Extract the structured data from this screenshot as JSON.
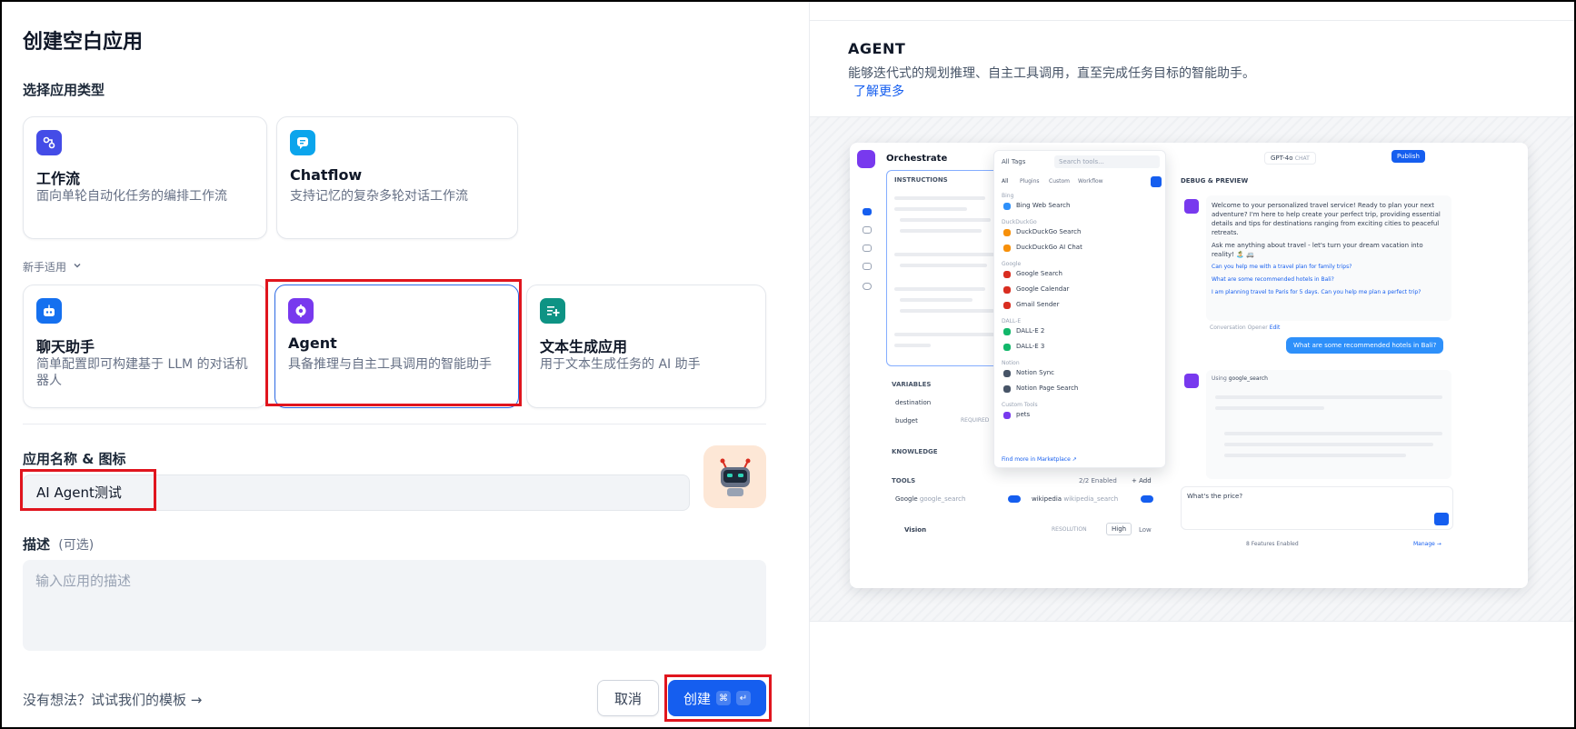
{
  "page_title": "创建空白应用",
  "select_type_label": "选择应用类型",
  "app_types_top": [
    {
      "title": "工作流",
      "desc": "面向单轮自动化任务的编排工作流",
      "color": "#444ce7",
      "icon": "workflow-icon"
    },
    {
      "title": "Chatflow",
      "desc": "支持记忆的复杂多轮对话工作流",
      "color": "#0ba5ec",
      "icon": "chatflow-icon"
    }
  ],
  "beginner_label": "新手适用",
  "app_types_beginner": [
    {
      "title": "聊天助手",
      "desc": "简单配置即可构建基于 LLM 的对话机器人",
      "color": "#1570ef",
      "icon": "chatbot-icon"
    },
    {
      "title": "Agent",
      "desc": "具备推理与自主工具调用的智能助手",
      "color": "#7839ee",
      "icon": "agent-icon"
    },
    {
      "title": "文本生成应用",
      "desc": "用于文本生成任务的 AI 助手",
      "color": "#0e9384",
      "icon": "text-gen-icon"
    }
  ],
  "name_icon_label": "应用名称 & 图标",
  "name_value": "AI Agent测试",
  "desc_label": "描述",
  "desc_optional": "(可选)",
  "desc_placeholder": "输入应用的描述",
  "template_link": "没有想法？试试我们的模板 →",
  "cancel_label": "取消",
  "create_label": "创建",
  "create_kbd": [
    "⌘",
    "↵"
  ],
  "preview": {
    "title": "AGENT",
    "desc": "能够迭代式的规划推理、自主工具调用，直至完成任务目标的智能助手。",
    "learn_more": "了解更多",
    "mock": {
      "orchestrate": "Orchestrate",
      "instructions": "INSTRUCTIONS",
      "all_tags": "All Tags",
      "search_tools": "Search tools...",
      "tabs": [
        "All",
        "Plugins",
        "Custom",
        "Workflow"
      ],
      "groups": [
        {
          "name": "Bing",
          "items": [
            "Bing Web Search"
          ]
        },
        {
          "name": "DuckDuckGo",
          "items": [
            "DuckDuckGo Search",
            "DuckDuckGo AI Chat"
          ]
        },
        {
          "name": "Google",
          "items": [
            "Google Search",
            "Google Calendar",
            "Gmail Sender"
          ]
        },
        {
          "name": "DALL-E",
          "items": [
            "DALL-E 2",
            "DALL-E 3"
          ]
        },
        {
          "name": "Notion",
          "items": [
            "Notion Sync",
            "Notion Page Search"
          ]
        },
        {
          "name": "Custom Tools",
          "items": [
            "pets"
          ]
        }
      ],
      "find_more": "Find more in Marketplace ↗",
      "variables": "VARIABLES",
      "var_items": [
        "destination",
        "budget"
      ],
      "required": "REQUIRED",
      "knowledge": "KNOWLEDGE",
      "tools": "TOOLS",
      "tools_enabled": "2/2 Enabled",
      "add": "+ Add",
      "tool1": "Google",
      "tool1_sub": "google_search",
      "tool2": "wikipedia",
      "tool2_sub": "wikipedia_search",
      "vision": "Vision",
      "resolution": "RESOLUTION",
      "high": "High",
      "low": "Low",
      "model": "GPT-4o",
      "model_tag": "CHAT",
      "publish": "Publish",
      "debug": "DEBUG & PREVIEW",
      "welcome": "Welcome to your personalized travel service! Ready to plan your next adventure? I'm here to help create your perfect trip, providing essential details and tips for destinations ranging from exciting cities to peaceful retreats.",
      "ask": "Ask me anything about travel - let's turn your dream vacation into reality! 🏝️ 🚐",
      "suggestions": [
        "Can you help me with a travel plan for family trips?",
        "What are some recommended hotels in Bali?",
        "I am planning travel to Paris for 5 days. Can you help me plan a perfect trip?"
      ],
      "opener": "Conversation Opener",
      "opener_edit": "Edit",
      "user_msg": "What are some recommended hotels in Bali?",
      "using": "Using",
      "using_tool": "google_search",
      "input": "What's the price?",
      "features": "8 Features Enabled",
      "manage": "Manage →"
    }
  }
}
